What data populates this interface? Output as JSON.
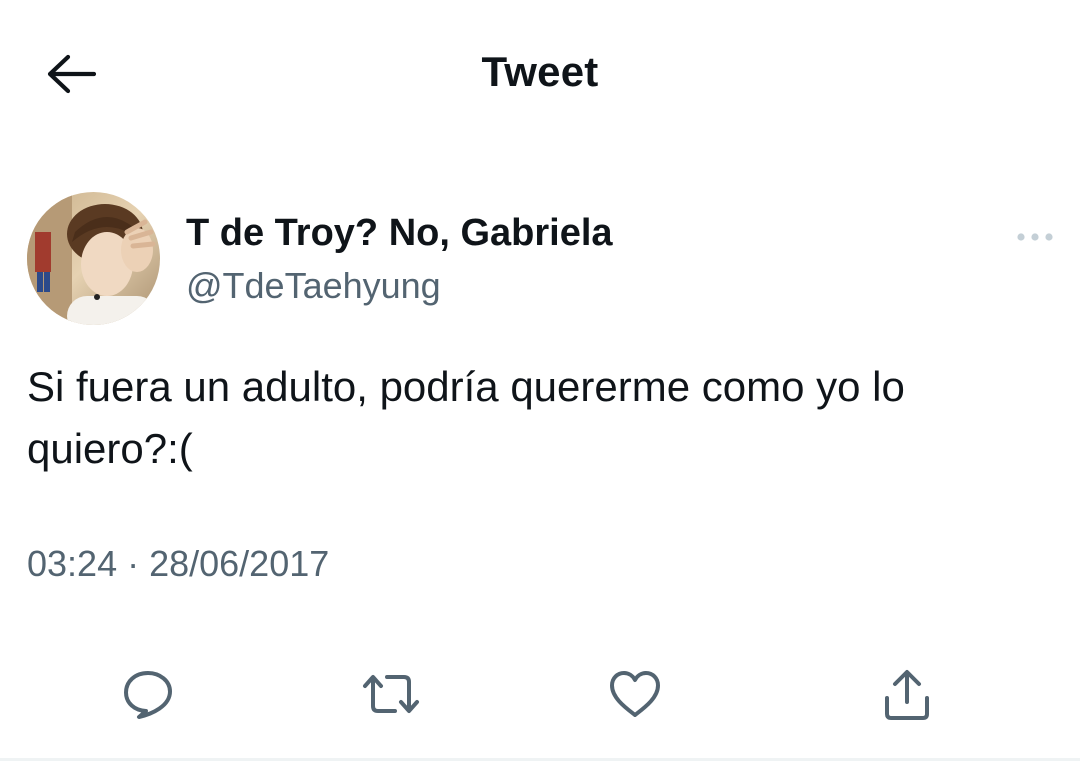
{
  "header": {
    "title": "Tweet",
    "back_icon": "arrow-left-icon"
  },
  "tweet": {
    "author": {
      "display_name": "T de Troy? No, Gabriela",
      "handle": "@TdeTaehyung"
    },
    "more_icon": "more-horizontal-icon",
    "text": "Si fuera un adulto, podría quererme como yo lo\nquiero?:(",
    "timestamp": "03:24 · 28/06/2017",
    "actions": [
      "reply-icon",
      "retweet-icon",
      "like-icon",
      "share-icon"
    ]
  },
  "colors": {
    "text_primary": "#0f1419",
    "text_secondary": "#536471",
    "icon": "#536471",
    "background": "#ffffff"
  }
}
